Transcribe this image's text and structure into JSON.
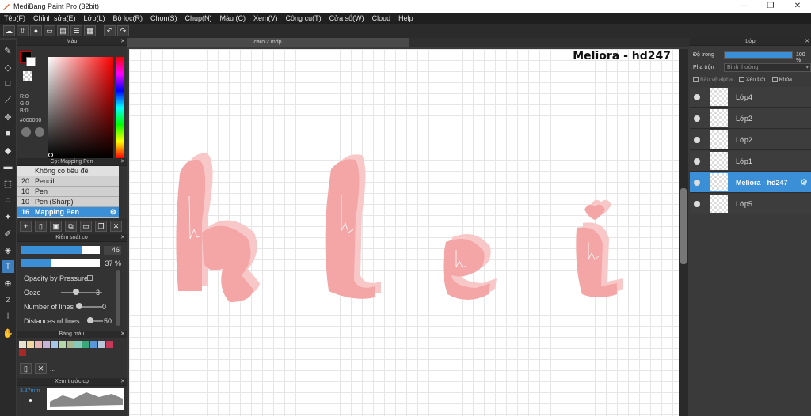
{
  "window": {
    "title": "MediBang Paint Pro (32bit)",
    "minimize": "—",
    "maximize": "❐",
    "close": "✕"
  },
  "menu": [
    "Tệp(F)",
    "Chỉnh sửa(E)",
    "Lớp(L)",
    "Bộ lọc(R)",
    "Chọn(S)",
    "Chụp(N)",
    "Màu (C)",
    "Xem(V)",
    "Công cụ(T)",
    "Cửa sổ(W)",
    "Cloud",
    "Help"
  ],
  "color_panel": {
    "title": "Màu",
    "r": "R:0",
    "g": "G:0",
    "b": "B:0",
    "hex": "#000000"
  },
  "brush_panel": {
    "title": "Cọ: Mapping Pen",
    "items": [
      {
        "size": "",
        "name": "Không có tiêu đề"
      },
      {
        "size": "20",
        "name": "Pencil"
      },
      {
        "size": "10",
        "name": "Pen"
      },
      {
        "size": "10",
        "name": "Pen (Sharp)"
      },
      {
        "size": "16",
        "name": "Mapping Pen"
      }
    ]
  },
  "brush_control": {
    "title": "Kiểm soát cọ",
    "size_value": "46",
    "opacity_value": "37 %",
    "size_fill": 0.78,
    "opacity_fill": 0.37,
    "opacity_by_pressure": "Opacity by Pressure",
    "ooze_label": "Ooze",
    "ooze_value": "3",
    "lines_label": "Number of lines",
    "lines_value": "0",
    "dist_label": "Distances of lines",
    "dist_value": "50"
  },
  "palette": {
    "title": "Bảng màu",
    "colors": [
      "#e8e2d0",
      "#f2d6a0",
      "#e8b4b4",
      "#c8b4d8",
      "#a8c8e8",
      "#b4d8a8",
      "#a8b890",
      "#88c8b8",
      "#38a878",
      "#5898d8",
      "#b8c8d8",
      "#c83858",
      "#a82828"
    ],
    "ellipsis": "..."
  },
  "preview": {
    "title": "Xem trước cọ",
    "size": "3.37mm"
  },
  "document": {
    "tab": "caro 2.mdp",
    "watermark": "Meliora - hd247",
    "letters": [
      "h",
      "l",
      "e",
      "i"
    ]
  },
  "layers_panel": {
    "title": "Lớp",
    "opacity_label": "Độ trong",
    "opacity_value": "100 %",
    "blend_label": "Pha trộn",
    "blend_value": "Bình thường",
    "protect_alpha": "Bảo vệ alpha",
    "clip": "Xén bớt",
    "lock": "Khóa",
    "layers": [
      {
        "name": "Lớp4",
        "active": false
      },
      {
        "name": "Lớp2",
        "active": false
      },
      {
        "name": "Lớp2",
        "active": false
      },
      {
        "name": "Lớp1",
        "active": false
      },
      {
        "name": "Meliora - hd247",
        "active": true
      },
      {
        "name": "Lớp5",
        "active": false
      }
    ]
  }
}
